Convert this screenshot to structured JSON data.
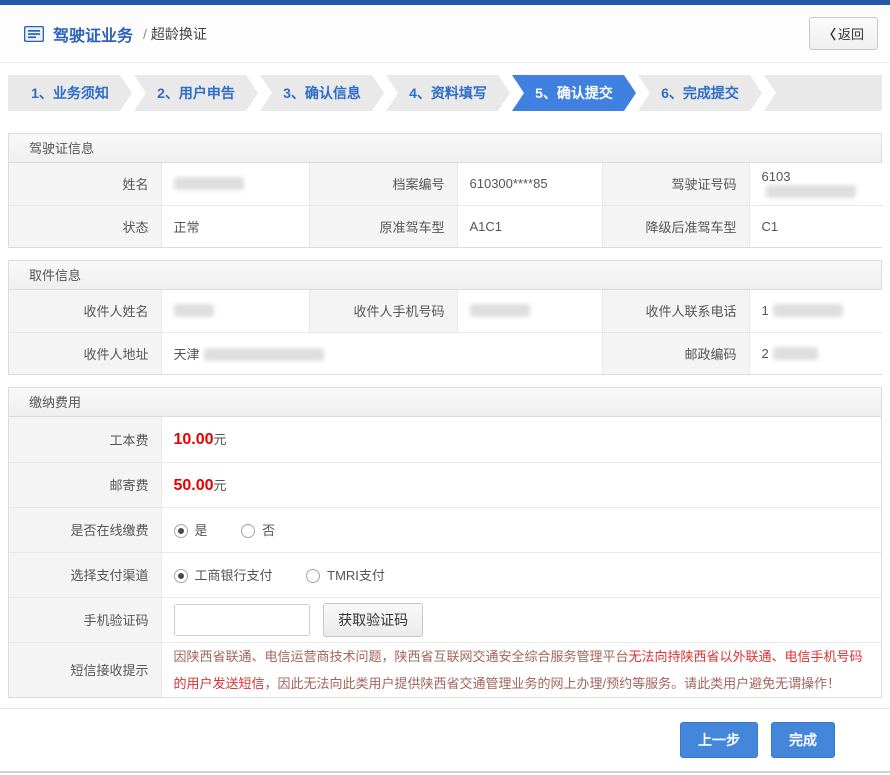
{
  "header": {
    "title": "驾驶证业务",
    "separator": "/",
    "subtitle": "超龄换证",
    "back": {
      "chevron": "〈",
      "label": "返回"
    }
  },
  "steps": [
    {
      "label": "1、业务须知",
      "active": false
    },
    {
      "label": "2、用户申告",
      "active": false
    },
    {
      "label": "3、确认信息",
      "active": false
    },
    {
      "label": "4、资料填写",
      "active": false
    },
    {
      "label": "5、确认提交",
      "active": true
    },
    {
      "label": "6、完成提交",
      "active": false
    }
  ],
  "license_section": {
    "title": "驾驶证信息",
    "name_label": "姓名",
    "name_masked": true,
    "file_no_label": "档案编号",
    "file_no_value": "610300****85",
    "license_no_label": "驾驶证号码",
    "license_no_prefix": "6103",
    "license_no_masked": true,
    "status_label": "状态",
    "status_value": "正常",
    "orig_class_label": "原准驾车型",
    "orig_class_value": "A1C1",
    "downgrade_class_label": "降级后准驾车型",
    "downgrade_class_value": "C1"
  },
  "pickup_section": {
    "title": "取件信息",
    "recipient_name_label": "收件人姓名",
    "recipient_name_masked": true,
    "recipient_mobile_label": "收件人手机号码",
    "recipient_mobile_masked": true,
    "recipient_phone_label": "收件人联系电话",
    "recipient_phone_prefix": "1",
    "recipient_phone_masked": true,
    "address_label": "收件人地址",
    "address_prefix": "天津",
    "address_masked": true,
    "postcode_label": "邮政编码",
    "postcode_prefix": "2",
    "postcode_masked": true
  },
  "payment_section": {
    "title": "缴纳费用",
    "work_fee_label": "工本费",
    "work_fee_amount": "10.00",
    "work_fee_unit": "元",
    "post_fee_label": "邮寄费",
    "post_fee_amount": "50.00",
    "post_fee_unit": "元",
    "online_pay_label": "是否在线缴费",
    "online_yes": "是",
    "online_yes_selected": true,
    "online_no": "否",
    "channel_label": "选择支付渠道",
    "channel_icbc": "工商银行支付",
    "channel_icbc_selected": true,
    "channel_tmri": "TMRI支付",
    "sms_code_label": "手机验证码",
    "sms_code_value": "",
    "get_code_button": "获取验证码",
    "notice_label": "短信接收提示",
    "notice_seg1": "因陕西省联通、电信运营商技术问题，陕西省互联网交通安全综合服务管理平台",
    "notice_seg2": "无法向持陕西省以外联通、电信手机号码的用户发送短信",
    "notice_seg3": "，因此无法向此类用户提供陕西省交通管理业务的网上办理/预约等服务。请此类用户避免无谓操作！"
  },
  "footer": {
    "prev_button": "上一步",
    "finish_button": "完成"
  },
  "colors": {
    "top_bar_blue": "#2458a8",
    "title_blue": "#2b62b8",
    "step_text_blue": "#2e6dc8",
    "active_step_blue": "#3f80e0",
    "button_blue": "#4486d9",
    "fee_red": "#e60000",
    "notice_muted": "#a2645c",
    "notice_bright": "#e03030"
  }
}
